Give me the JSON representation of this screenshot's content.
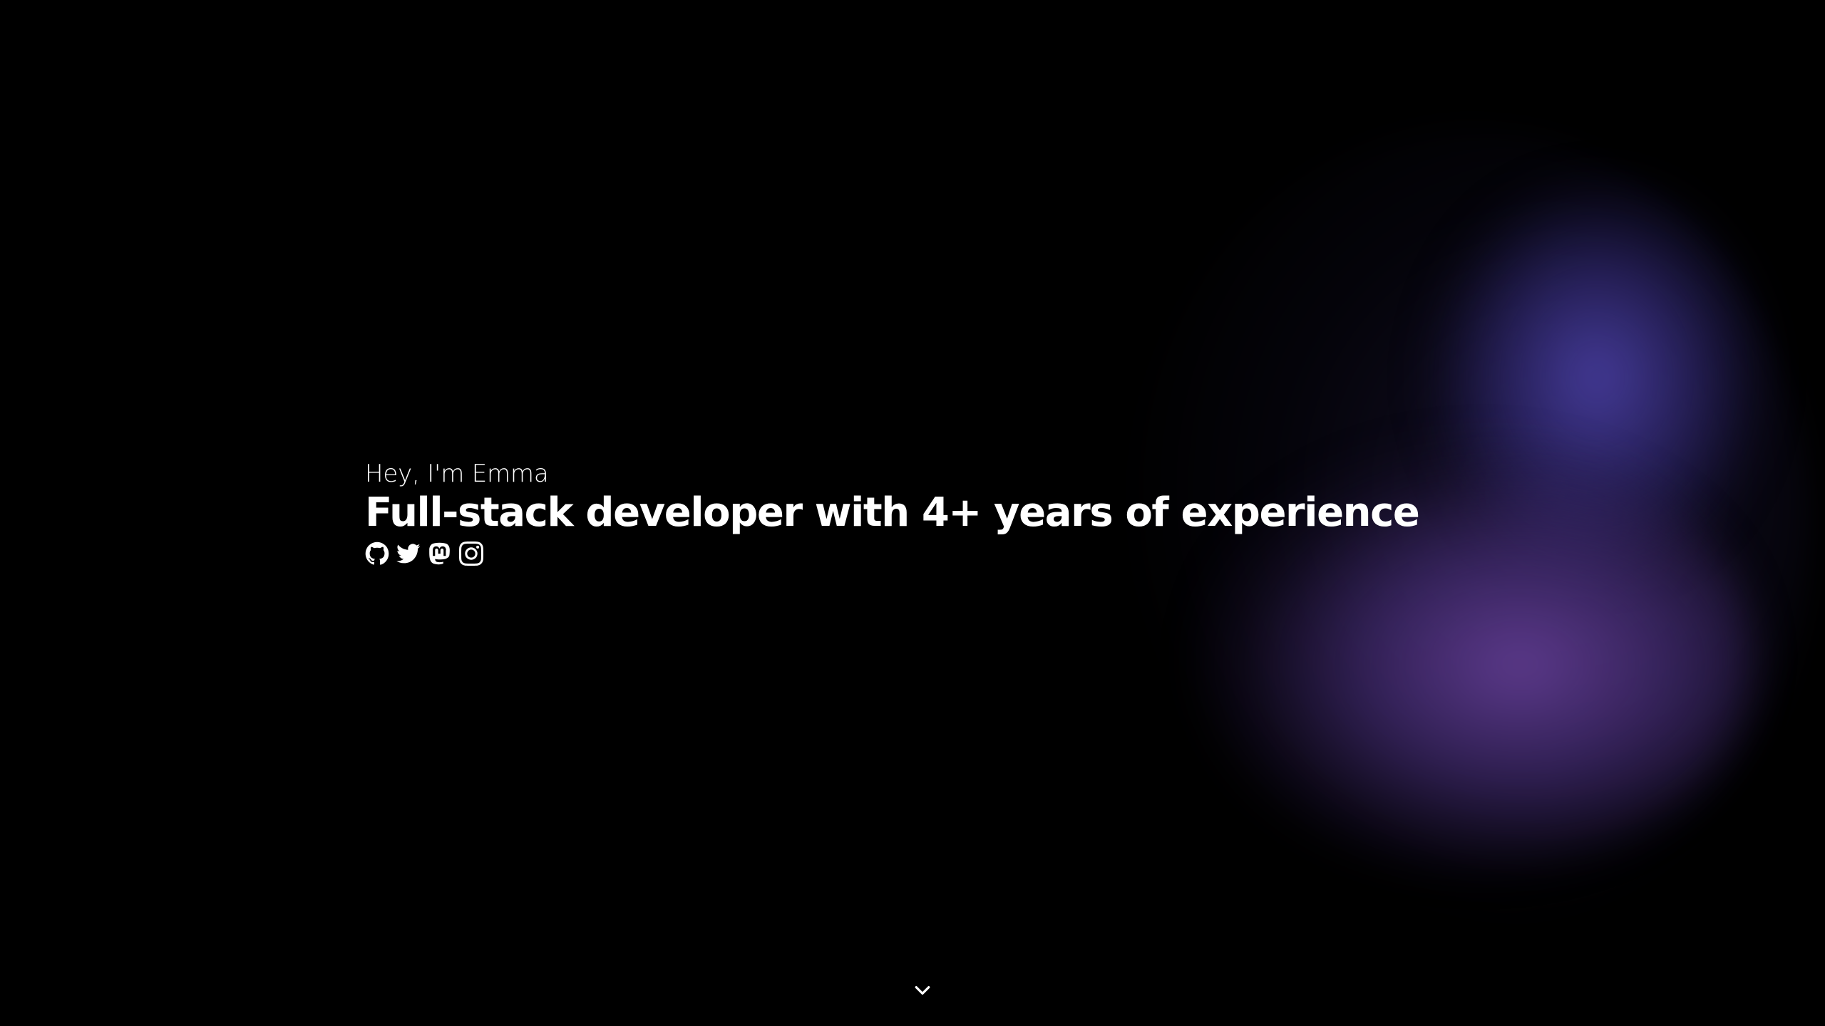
{
  "hero": {
    "greeting": "Hey, I'm Emma",
    "headline": "Full-stack developer with 4+ years of experience"
  },
  "socials": [
    {
      "icon": "github-icon"
    },
    {
      "icon": "twitter-icon"
    },
    {
      "icon": "mastodon-icon"
    },
    {
      "icon": "instagram-icon"
    }
  ],
  "scroll": {
    "icon": "chevron-down-icon"
  },
  "colors": {
    "background": "#000000",
    "text": "#ffffff",
    "glow_blue": "#483ea0",
    "glow_purple": "#643e96"
  }
}
